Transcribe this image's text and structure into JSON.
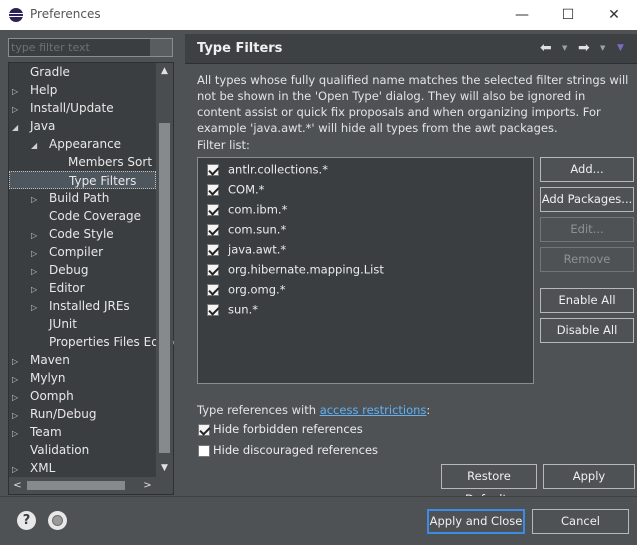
{
  "window": {
    "title": "Preferences",
    "minimize": "—",
    "maximize": "☐",
    "close": "✕"
  },
  "sidebar": {
    "filter_placeholder": "type filter text",
    "items": [
      {
        "label": "Gradle",
        "arrow": ""
      },
      {
        "label": "Help",
        "arrow": "▷"
      },
      {
        "label": "Install/Update",
        "arrow": "▷"
      },
      {
        "label": "Java",
        "arrow": "◢"
      },
      {
        "label": "Appearance",
        "arrow": "◢"
      },
      {
        "label": "Members Sort O",
        "arrow": ""
      },
      {
        "label": "Type Filters",
        "arrow": ""
      },
      {
        "label": "Build Path",
        "arrow": "▷"
      },
      {
        "label": "Code Coverage",
        "arrow": ""
      },
      {
        "label": "Code Style",
        "arrow": "▷"
      },
      {
        "label": "Compiler",
        "arrow": "▷"
      },
      {
        "label": "Debug",
        "arrow": "▷"
      },
      {
        "label": "Editor",
        "arrow": "▷"
      },
      {
        "label": "Installed JREs",
        "arrow": "▷"
      },
      {
        "label": "JUnit",
        "arrow": ""
      },
      {
        "label": "Properties Files Edito",
        "arrow": ""
      },
      {
        "label": "Maven",
        "arrow": "▷"
      },
      {
        "label": "Mylyn",
        "arrow": "▷"
      },
      {
        "label": "Oomph",
        "arrow": "▷"
      },
      {
        "label": "Run/Debug",
        "arrow": "▷"
      },
      {
        "label": "Team",
        "arrow": "▷"
      },
      {
        "label": "Validation",
        "arrow": ""
      },
      {
        "label": "XML",
        "arrow": "▷"
      }
    ],
    "scroll_up": "▲",
    "scroll_down": "▼",
    "scroll_left": "<",
    "scroll_right": ">"
  },
  "page": {
    "title": "Type Filters",
    "nav_back": "⬅",
    "nav_forward": "➡",
    "nav_menu": "▼",
    "description": "All types whose fully qualified name matches the selected filter strings will not be shown in the 'Open Type' dialog. They will also be ignored in content assist or quick fix proposals and when organizing imports. For example 'java.awt.*' will hide all types from the awt packages.",
    "filter_list_label": "Filter list:",
    "filters": [
      {
        "text": "antlr.collections.*",
        "checked": true
      },
      {
        "text": "COM.*",
        "checked": true
      },
      {
        "text": "com.ibm.*",
        "checked": true
      },
      {
        "text": "com.sun.*",
        "checked": true
      },
      {
        "text": "java.awt.*",
        "checked": true
      },
      {
        "text": "org.hibernate.mapping.List",
        "checked": true
      },
      {
        "text": "org.omg.*",
        "checked": true
      },
      {
        "text": "sun.*",
        "checked": true
      }
    ],
    "buttons": {
      "add": "Add...",
      "add_packages": "Add Packages...",
      "edit": "Edit...",
      "remove": "Remove",
      "enable_all": "Enable All",
      "disable_all": "Disable All"
    },
    "type_refs_prefix": "Type references with ",
    "type_refs_link": "access restrictions",
    "type_refs_suffix": ":",
    "hide_forbidden": {
      "label": "Hide forbidden references",
      "checked": true
    },
    "hide_discouraged": {
      "label": "Hide discouraged references",
      "checked": false
    },
    "restore_defaults": "Restore Defaults",
    "apply": "Apply"
  },
  "footer": {
    "help": "?",
    "apply_close": "Apply and Close",
    "cancel": "Cancel"
  }
}
